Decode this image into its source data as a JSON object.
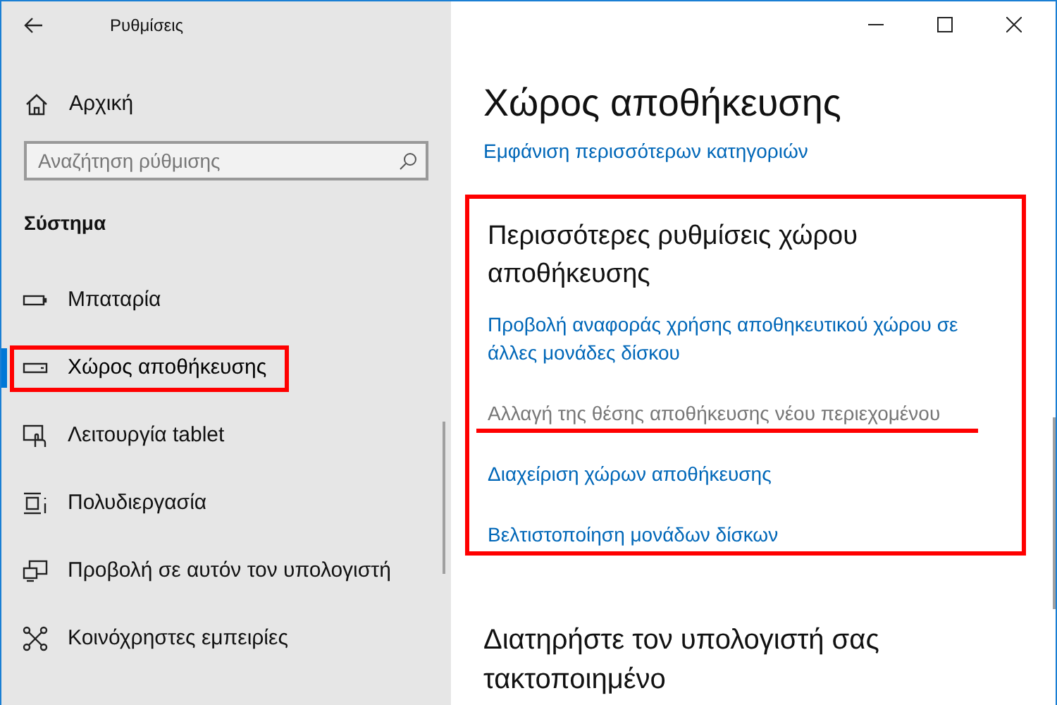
{
  "window": {
    "title": "Ρυθμίσεις"
  },
  "sidebar": {
    "home": "Αρχική",
    "search": {
      "placeholder": "Αναζήτηση ρύθμισης"
    },
    "section": "Σύστημα",
    "items": [
      {
        "label": "Μπαταρία",
        "kind": "battery",
        "selected": false,
        "highlighted": false
      },
      {
        "label": "Χώρος αποθήκευσης",
        "kind": "storage",
        "selected": true,
        "highlighted": true
      },
      {
        "label": "Λειτουργία tablet",
        "kind": "tablet",
        "selected": false,
        "highlighted": false
      },
      {
        "label": "Πολυδιεργασία",
        "kind": "multitask",
        "selected": false,
        "highlighted": false
      },
      {
        "label": "Προβολή σε αυτόν τον υπολογιστή",
        "kind": "project",
        "selected": false,
        "highlighted": false
      },
      {
        "label": "Κοινόχρηστες εμπειρίες",
        "kind": "shared",
        "selected": false,
        "highlighted": false
      }
    ]
  },
  "main": {
    "title": "Χώρος αποθήκευσης",
    "more_link": "Εμφάνιση περισσότερων κατηγοριών",
    "section": {
      "title": "Περισσότερες ρυθμίσεις χώρου αποθήκευσης",
      "highlighted": true,
      "links": [
        {
          "label": "Προβολή αναφοράς χρήσης αποθηκευτικού χώρου σε άλλες μονάδες δίσκου",
          "disabled": false,
          "underlined": false
        },
        {
          "label": "Αλλαγή της θέσης αποθήκευσης νέου περιεχομένου",
          "disabled": true,
          "underlined": true
        },
        {
          "label": "Διαχείριση χώρων αποθήκευσης",
          "disabled": false,
          "underlined": false
        },
        {
          "label": "Βελτιστοποίηση μονάδων δίσκων",
          "disabled": false,
          "underlined": false
        }
      ]
    },
    "next_section": "Διατηρήστε τον υπολογιστή σας τακτοποιημένο"
  }
}
